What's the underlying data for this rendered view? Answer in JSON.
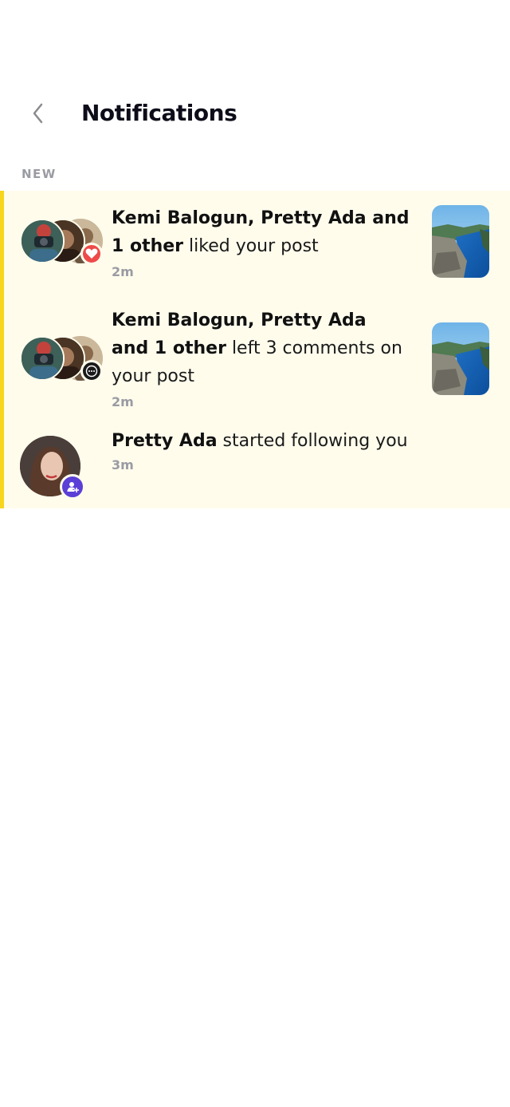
{
  "header": {
    "title": "Notifications",
    "back_icon": "chevron-left-icon"
  },
  "sections": {
    "new_label": "NEW"
  },
  "notifications": [
    {
      "actors": "Kemi Balogun, Pretty Ada and 1 other",
      "action": " liked your post",
      "time": "2m",
      "badge_icon": "heart-icon",
      "badge_color": "#ee4a4a"
    },
    {
      "actors": "Kemi Balogun, Pretty Ada and 1 other",
      "action": " left 3 comments on your post",
      "time": "2m",
      "badge_icon": "comment-icon",
      "badge_color": "#1a1a1a"
    },
    {
      "actors": "Pretty Ada",
      "action": " started following you",
      "time": "3m",
      "badge_icon": "user-add-icon",
      "badge_color": "#5b3fd6"
    }
  ],
  "colors": {
    "accent": "#f7d51d",
    "highlight_bg": "#fffcec",
    "muted": "#9a9ba3"
  }
}
